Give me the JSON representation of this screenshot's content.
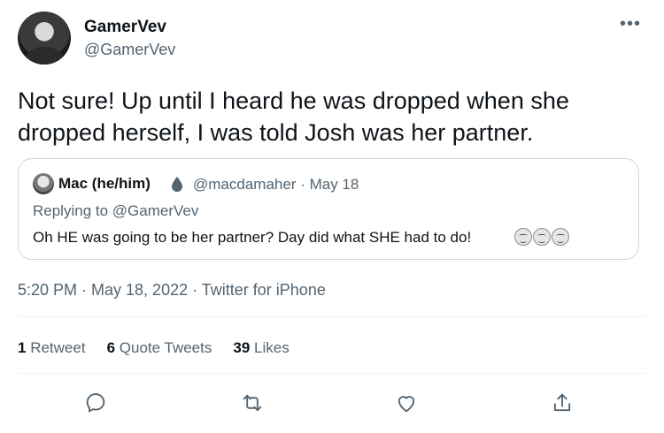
{
  "author": {
    "name": "GamerVev",
    "handle": "@GamerVev"
  },
  "tweet": {
    "text_line1": "Not sure! Up until I heard he was dropped when she",
    "text_line2": "dropped herself, I was told Josh was her partner."
  },
  "quoted_tweet": {
    "name": "Mac (he/him)",
    "handle": "@macdamaher",
    "date": "May 18",
    "replying_to": "Replying to @GamerVev",
    "text": "Oh HE was going to be her partner? Day did what SHE had to do!",
    "emojis": [
      "relieved-face",
      "relieved-face",
      "relieved-face"
    ]
  },
  "timestamp": "5:20 PM · May 18, 2022 · Twitter for iPhone",
  "stats": {
    "retweets_count": "1",
    "retweets_label": "Retweet",
    "quotes_count": "6",
    "quotes_label": "Quote Tweets",
    "likes_count": "39",
    "likes_label": "Likes"
  },
  "actions": [
    "reply-icon",
    "retweet-icon",
    "like-icon",
    "share-icon"
  ],
  "more_label": "•••"
}
